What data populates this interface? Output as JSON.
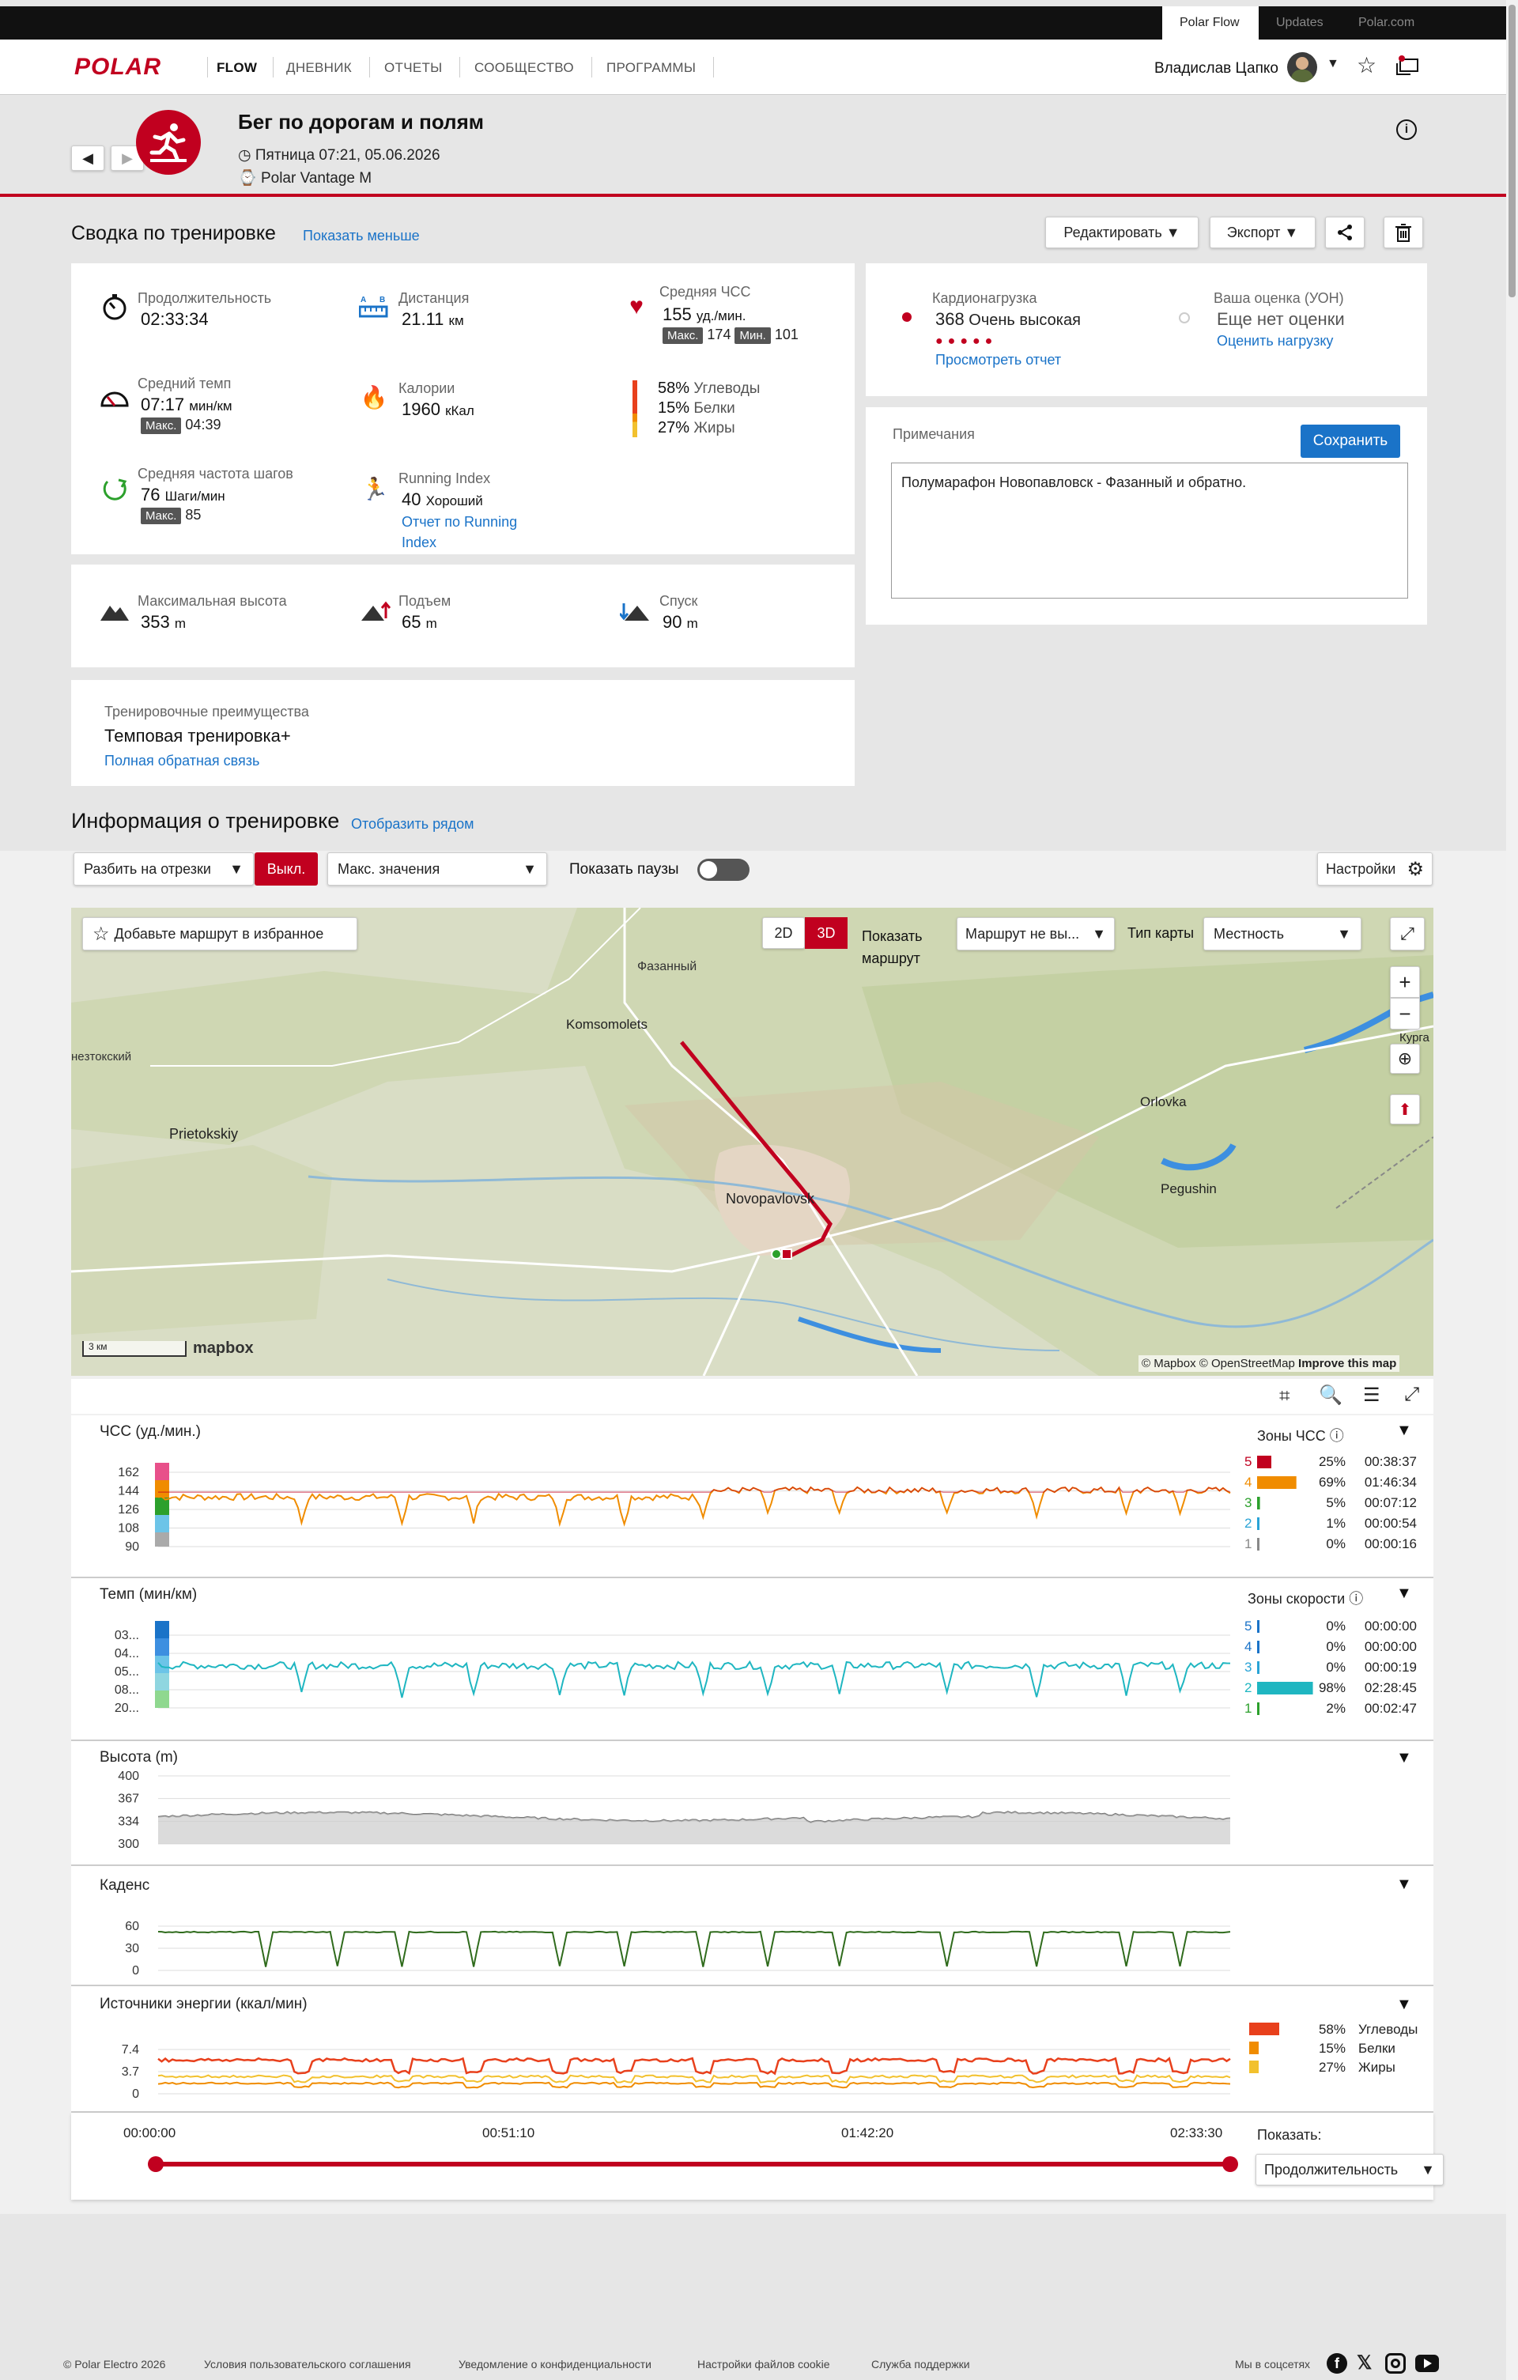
{
  "topbar": {
    "tabs": [
      "Polar Flow",
      "Updates",
      "Polar.com"
    ]
  },
  "nav": {
    "logo": "POLAR",
    "flow": "FLOW",
    "items": [
      "ДНЕВНИК",
      "ОТЧЕТЫ",
      "СООБЩЕСТВО",
      "ПРОГРАММЫ"
    ],
    "user": "Владислав Цапко"
  },
  "session": {
    "title": "Бег по дорогам и полям",
    "datetime": "Пятница 07:21, 05.06.2026",
    "device": "Polar Vantage M"
  },
  "summary": {
    "title": "Сводка по тренировке",
    "show_less": "Показать меньше",
    "edit": "Редактировать",
    "export": "Экспорт",
    "duration": {
      "label": "Продолжительность",
      "value": "02:33:34"
    },
    "distance": {
      "label": "Дистанция",
      "value": "21.11",
      "unit": "км"
    },
    "hr": {
      "label": "Средняя ЧСС",
      "value": "155",
      "unit": "уд./мин.",
      "max_label": "Макс.",
      "max": "174",
      "min_label": "Мин.",
      "min": "101"
    },
    "pace": {
      "label": "Средний темп",
      "value": "07:17",
      "unit": "мин/км",
      "max_label": "Макс.",
      "max": "04:39"
    },
    "calories": {
      "label": "Калории",
      "value": "1960",
      "unit": "кКал"
    },
    "energy": [
      {
        "pct": "58%",
        "name": "Углеводы"
      },
      {
        "pct": "15%",
        "name": "Белки"
      },
      {
        "pct": "27%",
        "name": "Жиры"
      }
    ],
    "cadence": {
      "label": "Средняя частота шагов",
      "value": "76",
      "unit": "Шаги/мин",
      "max_label": "Макс.",
      "max": "85"
    },
    "running_index": {
      "label": "Running Index",
      "value": "40",
      "desc": "Хороший",
      "link1": "Отчет по Running",
      "link2": "Index"
    },
    "altitude": {
      "label": "Максимальная высота",
      "value": "353",
      "unit": "m"
    },
    "ascent": {
      "label": "Подъем",
      "value": "65",
      "unit": "m"
    },
    "descent": {
      "label": "Спуск",
      "value": "90",
      "unit": "m"
    },
    "benefit": {
      "label": "Тренировочные преимущества",
      "value": "Темповая тренировка+",
      "link": "Полная обратная связь"
    }
  },
  "load": {
    "label": "Кардионагрузка",
    "value": "368",
    "desc": "Очень высокая",
    "link": "Просмотреть отчет",
    "rpe_label": "Ваша оценка (УОН)",
    "rpe_value": "Еще нет оценки",
    "rpe_link": "Оценить нагрузку"
  },
  "notes": {
    "label": "Примечания",
    "save": "Сохранить",
    "text": "Полумарафон Новопавловск - Фазанный и обратно."
  },
  "info": {
    "title": "Информация о тренировке",
    "side": "Отобразить рядом",
    "split": "Разбить на отрезки",
    "off": "Выкл.",
    "max": "Макс. значения",
    "pauses": "Показать паузы",
    "settings": "Настройки"
  },
  "map": {
    "fav": "Добавьте маршрут в избранное",
    "d2": "2D",
    "d3": "3D",
    "show1": "Показать",
    "show2": "маршрут",
    "route": "Маршрут не вы...",
    "type1": "Тип",
    "type2": "карты",
    "terrain": "Местность",
    "scale": "3 км",
    "attr1": "© Mapbox © OpenStreetMap",
    "attr2": "Improve this map",
    "mapbox": "mapbox",
    "places": [
      "Фазанный",
      "Komsomolets",
      "нeзтокский",
      "Prietokskiy",
      "Novopavlovsk",
      "Orlovka",
      "Pegushin",
      "Курга"
    ]
  },
  "graphs": {
    "hr": {
      "title": "ЧСС (уд./мин.)",
      "zones_title": "Зоны ЧСС",
      "ticks": [
        "162",
        "144",
        "126",
        "108",
        "90"
      ],
      "zones": [
        {
          "n": "5",
          "pct": "25%",
          "t": "00:38:37",
          "color": "#c1001f",
          "frac": 0.25
        },
        {
          "n": "4",
          "pct": "69%",
          "t": "01:46:34",
          "color": "#f08c00",
          "frac": 0.69
        },
        {
          "n": "3",
          "pct": "5%",
          "t": "00:07:12",
          "color": "#2ca02c",
          "frac": 0.05
        },
        {
          "n": "2",
          "pct": "1%",
          "t": "00:00:54",
          "color": "#29a3d6",
          "frac": 0.01
        },
        {
          "n": "1",
          "pct": "0%",
          "t": "00:00:16",
          "color": "#888",
          "frac": 0.0
        }
      ]
    },
    "pace": {
      "title": "Темп (мин/км)",
      "zones_title": "Зоны скорости",
      "ticks": [
        "03...",
        "04...",
        "05...",
        "08...",
        "20..."
      ],
      "zones": [
        {
          "n": "5",
          "pct": "0%",
          "t": "00:00:00",
          "color": "#1a73c8",
          "frac": 0
        },
        {
          "n": "4",
          "pct": "0%",
          "t": "00:00:00",
          "color": "#1a73c8",
          "frac": 0
        },
        {
          "n": "3",
          "pct": "0%",
          "t": "00:00:19",
          "color": "#29a3d6",
          "frac": 0
        },
        {
          "n": "2",
          "pct": "98%",
          "t": "02:28:45",
          "color": "#1fb6c1",
          "frac": 0.98
        },
        {
          "n": "1",
          "pct": "2%",
          "t": "00:02:47",
          "color": "#2ca02c",
          "frac": 0.02
        }
      ]
    },
    "alt": {
      "title": "Высота (m)",
      "ticks": [
        "400",
        "367",
        "334",
        "300"
      ]
    },
    "cad": {
      "title": "Каденс",
      "ticks": [
        "60",
        "30",
        "0"
      ]
    },
    "energy": {
      "title": "Источники энергии (ккал/мин)",
      "ticks": [
        "7.4",
        "3.7",
        "0"
      ],
      "legend": [
        {
          "pct": "58%",
          "name": "Углеводы",
          "color": "#e8401c"
        },
        {
          "pct": "15%",
          "name": "Белки",
          "color": "#f08c00"
        },
        {
          "pct": "27%",
          "name": "Жиры",
          "color": "#f2c12e"
        }
      ]
    }
  },
  "timeline": {
    "labels": [
      "00:00:00",
      "00:51:10",
      "01:42:20",
      "02:33:30"
    ],
    "show": "Показать:",
    "select": "Продолжительность"
  },
  "footer": {
    "copyright": "© Polar Electro 2026",
    "links": [
      "Условия пользовательского соглашения",
      "Уведомление о конфиденциальности",
      "Настройки файлов cookie",
      "Служба поддержки"
    ],
    "social": "Мы в соцсетях"
  },
  "colors": {
    "accent": "#c1001f",
    "link": "#1a73c8"
  }
}
